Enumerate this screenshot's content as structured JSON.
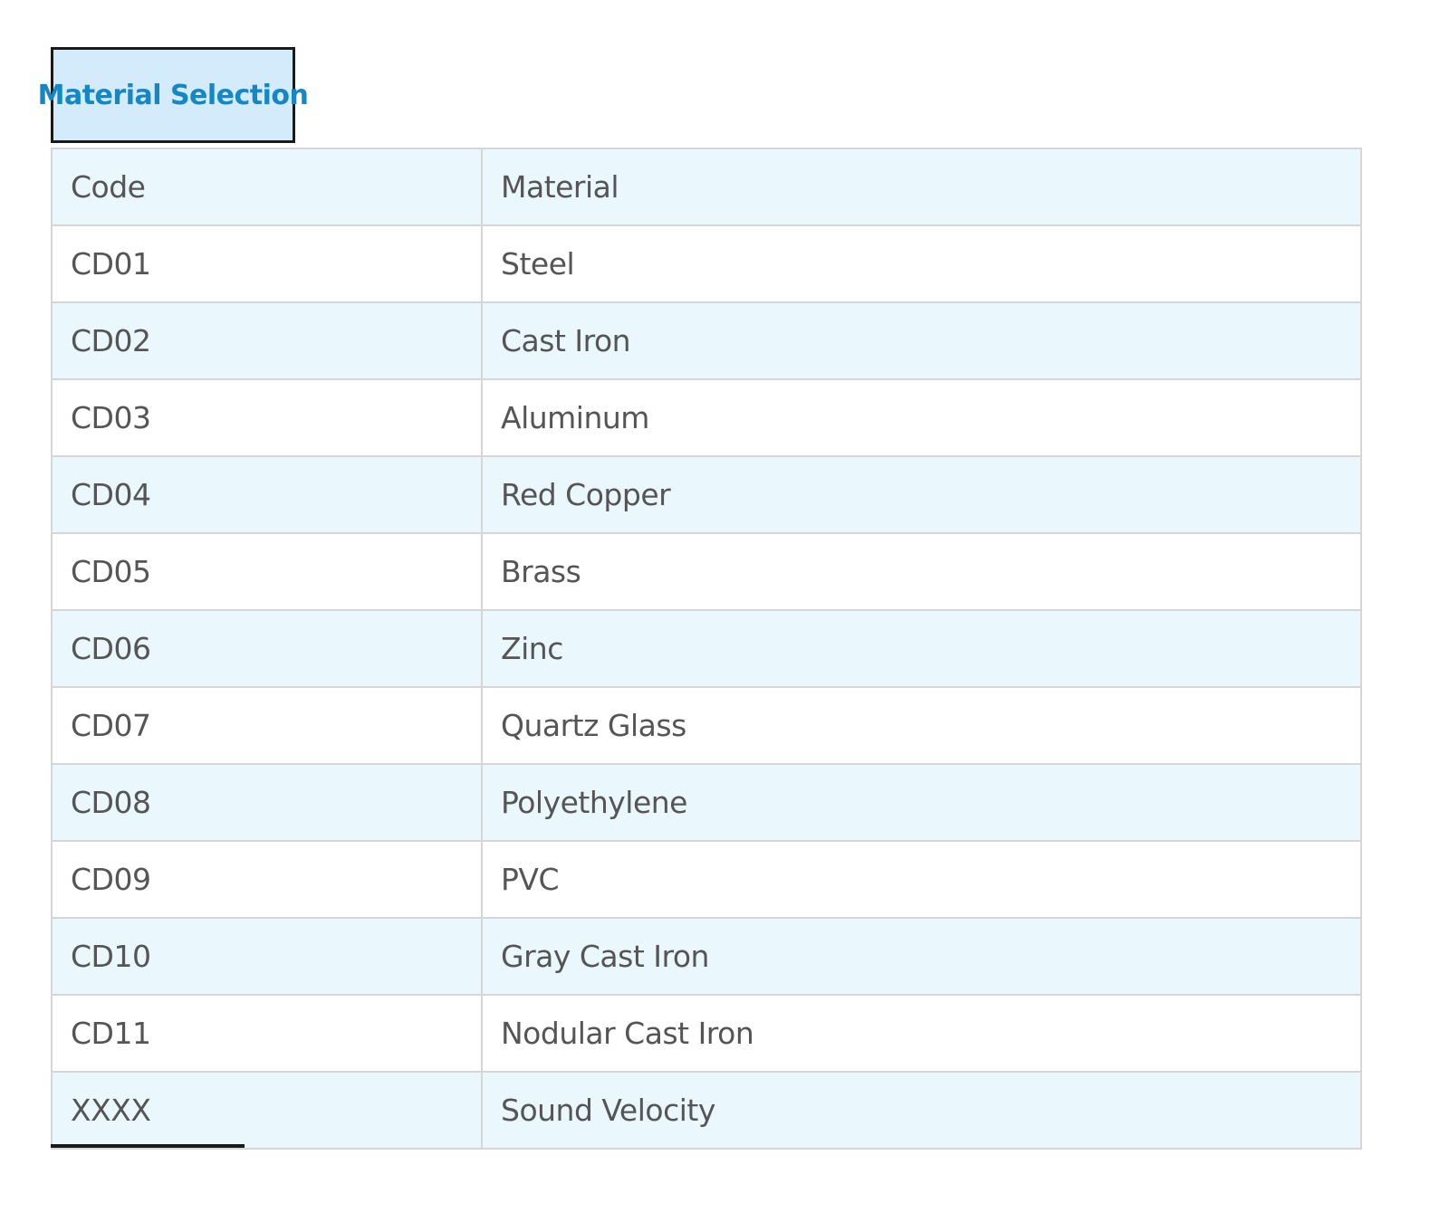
{
  "tab": {
    "label": "Material Selection"
  },
  "table": {
    "headers": [
      "Code",
      "Material"
    ],
    "rows": [
      {
        "code": "CD01",
        "material": "Steel"
      },
      {
        "code": "CD02",
        "material": "Cast Iron"
      },
      {
        "code": "CD03",
        "material": "Aluminum"
      },
      {
        "code": "CD04",
        "material": "Red Copper"
      },
      {
        "code": "CD05",
        "material": "Brass"
      },
      {
        "code": "CD06",
        "material": "Zinc"
      },
      {
        "code": "CD07",
        "material": "Quartz Glass"
      },
      {
        "code": "CD08",
        "material": "Polyethylene"
      },
      {
        "code": "CD09",
        "material": "PVC"
      },
      {
        "code": "CD10",
        "material": "Gray Cast Iron"
      },
      {
        "code": "CD11",
        "material": "Nodular Cast Iron"
      },
      {
        "code": "XXXX",
        "material": "Sound Velocity"
      }
    ]
  },
  "colors": {
    "tab_background": "#d4ebfb",
    "tab_text": "#1487c4",
    "row_band": "#eaf7fd",
    "cell_text": "#555555",
    "grid_line": "#d6d6d6"
  }
}
